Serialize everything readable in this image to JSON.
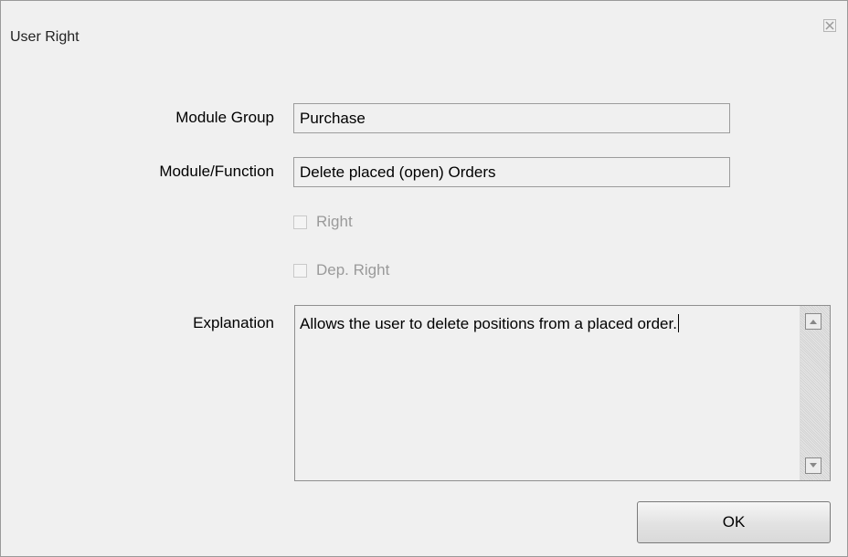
{
  "window": {
    "title": "User Right",
    "close_icon": "close-icon"
  },
  "form": {
    "module_group_label": "Module Group",
    "module_group_value": "Purchase",
    "module_function_label": "Module/Function",
    "module_function_value": "Delete placed (open) Orders",
    "right_label": "Right",
    "right_checked": false,
    "dep_right_label": "Dep. Right",
    "dep_right_checked": false,
    "explanation_label": "Explanation",
    "explanation_value": "Allows the user to delete positions from a placed order."
  },
  "buttons": {
    "ok_label": "OK"
  },
  "colors": {
    "background": "#f0f0f0",
    "border": "#9c9c9c",
    "disabled_text": "#9a9a9a"
  }
}
